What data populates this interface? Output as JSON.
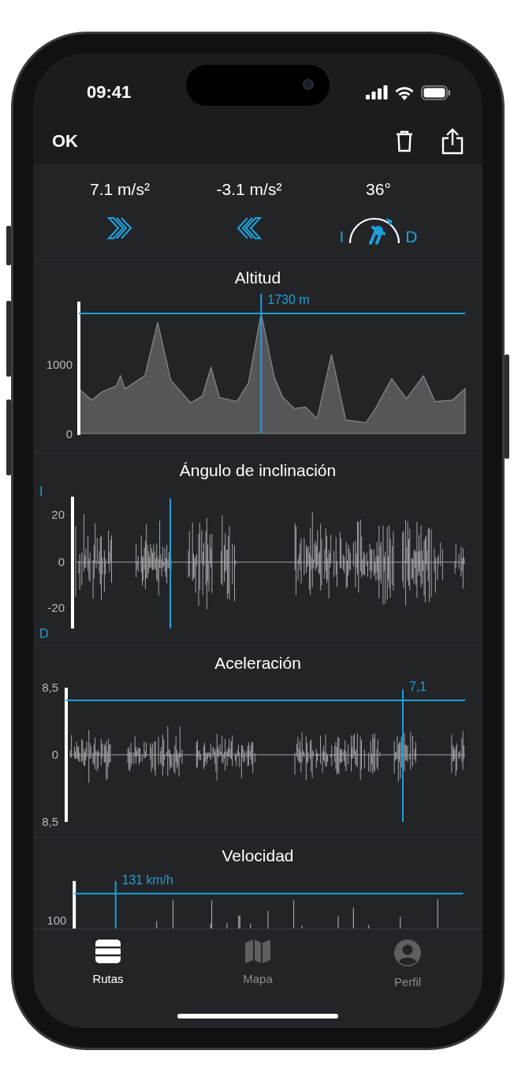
{
  "status_bar": {
    "time": "09:41"
  },
  "nav_bar": {
    "done": "OK"
  },
  "stats": [
    {
      "kind": "accel",
      "value": "7.1 m/s²"
    },
    {
      "kind": "brake",
      "value": "-3.1 m/s²"
    },
    {
      "kind": "lean",
      "value": "36°",
      "left_label": "I",
      "right_label": "D"
    }
  ],
  "charts": [
    {
      "kind": "area",
      "title": "Altitud",
      "marker": "1730 m",
      "ticks": [
        "1000",
        "0"
      ]
    },
    {
      "kind": "wave",
      "title": "Ángulo de inclinación",
      "top_label": "I",
      "bottom_label": "D",
      "ticks": [
        "20",
        "0",
        "-20"
      ]
    },
    {
      "kind": "wave",
      "title": "Aceleración",
      "marker": "7,1",
      "ticks": [
        "8,5",
        "0",
        "8,5"
      ]
    },
    {
      "kind": "spikes",
      "title": "Velocidad",
      "marker": "131 km/h",
      "ticks": [
        "100"
      ]
    }
  ],
  "tabs": [
    {
      "label": "Rutas",
      "selected": true
    },
    {
      "label": "Mapa",
      "selected": false
    },
    {
      "label": "Perfil",
      "selected": false
    }
  ]
}
